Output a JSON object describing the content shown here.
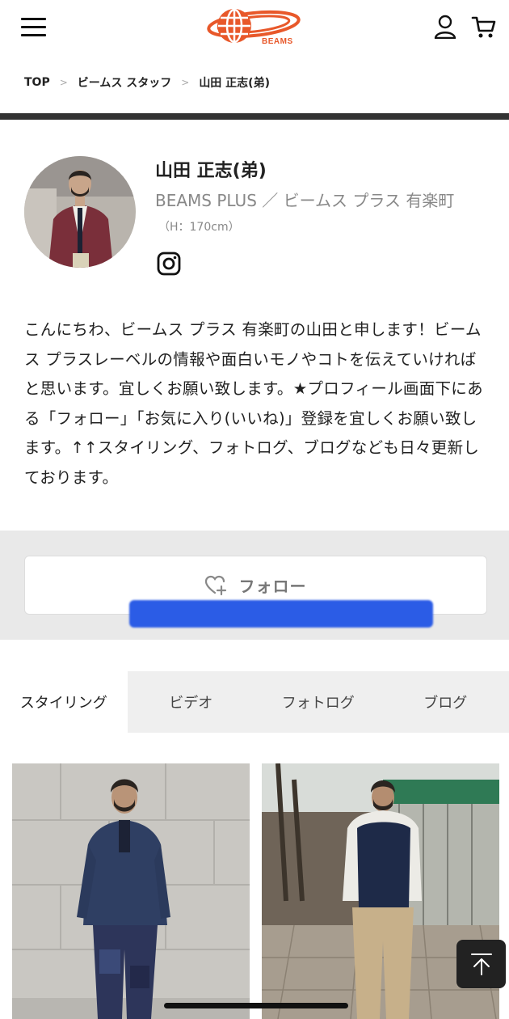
{
  "header": {
    "logo_text": "BEAMS",
    "brand_color": "#e8582a",
    "icons": [
      "menu-icon",
      "user-icon",
      "cart-icon"
    ]
  },
  "breadcrumb": [
    {
      "label": "TOP"
    },
    {
      "label": "ビームス スタッフ"
    },
    {
      "label": "山田 正志(弟)"
    }
  ],
  "breadcrumb_separator": ">",
  "profile": {
    "name": "山田 正志(弟)",
    "shop": "BEAMS PLUS ／ ビームス プラス 有楽町",
    "height": "（H：170cm）",
    "social_icon": "instagram-icon",
    "bio": "こんにちわ、ビームス プラス 有楽町の山田と申します！ビームス プラスレーベルの情報や面白いモノやコトを伝えていければと思います。宜しくお願い致します。★プロフィール画面下にある「フォロー」「お気に入り(いいね)」登録を宜しくお願い致します。↑↑スタイリング、フォトログ、ブログなども日々更新しております。"
  },
  "follow": {
    "label": "フォロー",
    "icon": "heart-plus-icon"
  },
  "tabs": [
    {
      "label": "スタイリング",
      "active": true
    },
    {
      "label": "ビデオ",
      "active": false
    },
    {
      "label": "フォトログ",
      "active": false
    },
    {
      "label": "ブログ",
      "active": false
    }
  ],
  "photos": [
    {
      "name": "styling-photo"
    },
    {
      "name": "styling-photo"
    }
  ],
  "scroll_top_icon": "arrow-up-to-top-icon"
}
